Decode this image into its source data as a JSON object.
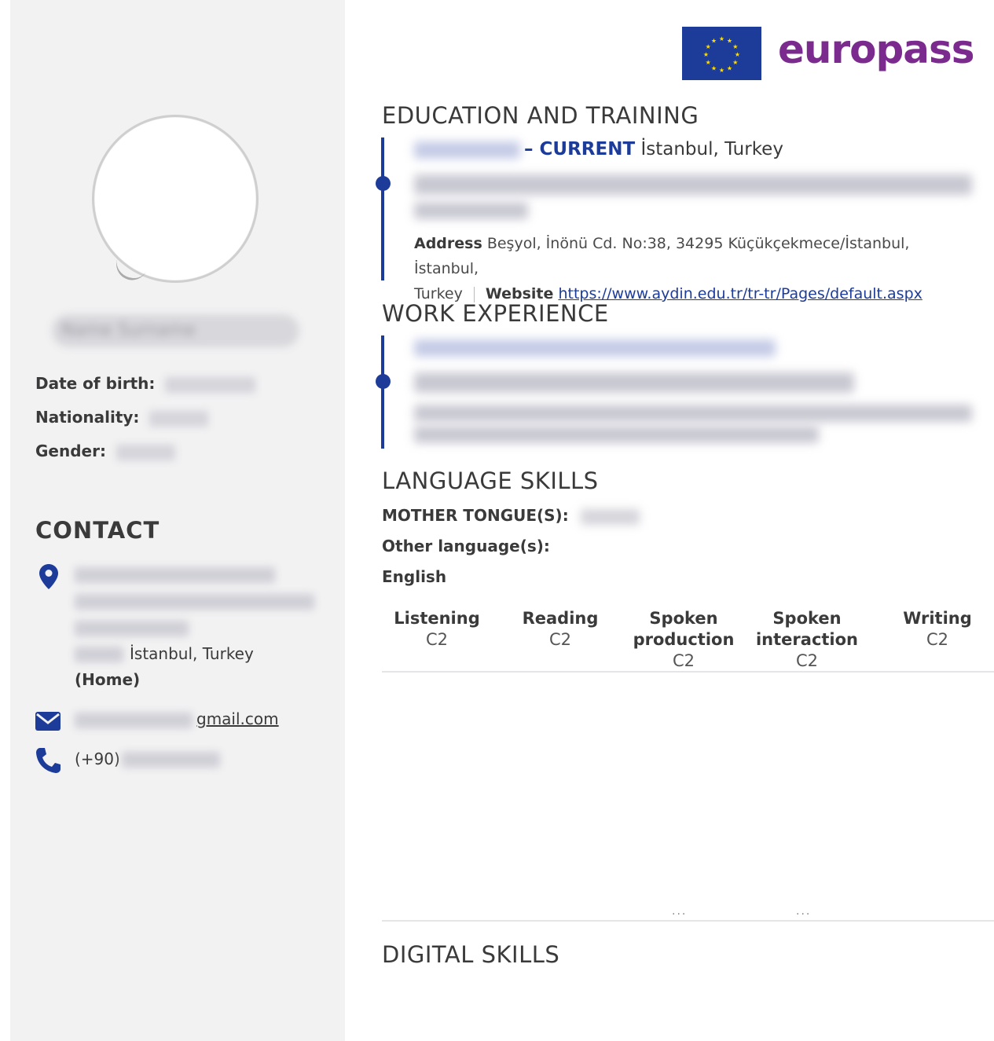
{
  "sidebar": {
    "name_placeholder": "Name Surname",
    "date_of_birth_label": "Date of birth:",
    "date_of_birth_value": "",
    "nationality_label": "Nationality:",
    "nationality_value": "",
    "gender_label": "Gender:",
    "gender_value": "",
    "contact_title": "CONTACT",
    "address_city": "İstanbul, Turkey",
    "address_type": "(Home)",
    "email_suffix": "gmail.com",
    "phone_prefix": "(+90)",
    "icons": {
      "address": "map-pin-icon",
      "email": "envelope-icon",
      "phone": "phone-icon"
    }
  },
  "logo": {
    "text": "europass",
    "flag": "eu-flag-icon"
  },
  "education": {
    "title": "EDUCATION AND TRAINING",
    "current_label": "– CURRENT",
    "location": "İstanbul, Turkey",
    "address_label": "Address",
    "address_value": "Beşyol, İnönü Cd. No:38, 34295 Küçükçekmece/İstanbul, İstanbul,",
    "address_value_2": "Turkey",
    "website_label": "Website",
    "website_url": "https://www.aydin.edu.tr/tr-tr/Pages/default.aspx"
  },
  "work": {
    "title": "WORK EXPERIENCE"
  },
  "language": {
    "title": "LANGUAGE SKILLS",
    "mother_tongue_label": "MOTHER TONGUE(S):",
    "other_label": "Other language(s):",
    "language_name": "English",
    "columns": [
      {
        "h1": "Listening",
        "h2": "",
        "v": "C2"
      },
      {
        "h1": "Reading",
        "h2": "",
        "v": "C2"
      },
      {
        "h1": "Spoken",
        "h2": "production",
        "v": "C2"
      },
      {
        "h1": "Spoken",
        "h2": "interaction",
        "v": "C2"
      },
      {
        "h1": "Writing",
        "h2": "",
        "v": "C2"
      }
    ],
    "ellipsis": "..."
  },
  "digital": {
    "title": "DIGITAL SKILLS"
  },
  "colors": {
    "accent": "#1d3c99",
    "brand": "#7b2b8e",
    "sidebar_bg": "#f2f2f3"
  }
}
